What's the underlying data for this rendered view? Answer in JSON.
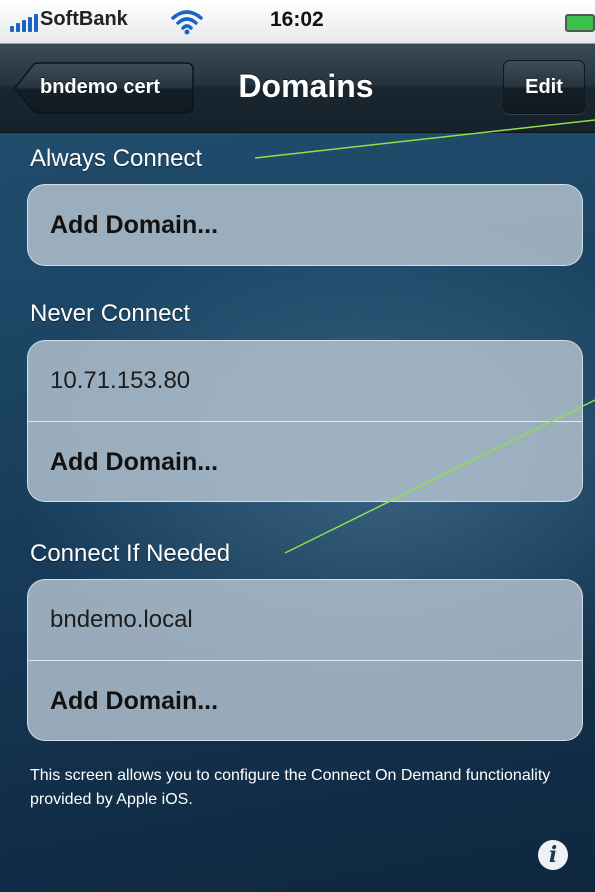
{
  "status_bar": {
    "carrier": "SoftBank",
    "time": "16:02"
  },
  "nav": {
    "back_label": "bndemo cert",
    "title": "Domains",
    "edit_label": "Edit"
  },
  "sections": [
    {
      "label": "Always Connect",
      "items": [],
      "add_label": "Add Domain..."
    },
    {
      "label": "Never Connect",
      "items": [
        "10.71.153.80"
      ],
      "add_label": "Add Domain..."
    },
    {
      "label": "Connect If Needed",
      "items": [
        "bndemo.local"
      ],
      "add_label": "Add Domain..."
    }
  ],
  "footer_note": "This screen allows you to configure the Connect On Demand functionality provided by Apple iOS.",
  "info_glyph": "i",
  "colors": {
    "background": "#173c5a",
    "annotation_line": "#8ee04a",
    "battery": "#3cc24a"
  }
}
